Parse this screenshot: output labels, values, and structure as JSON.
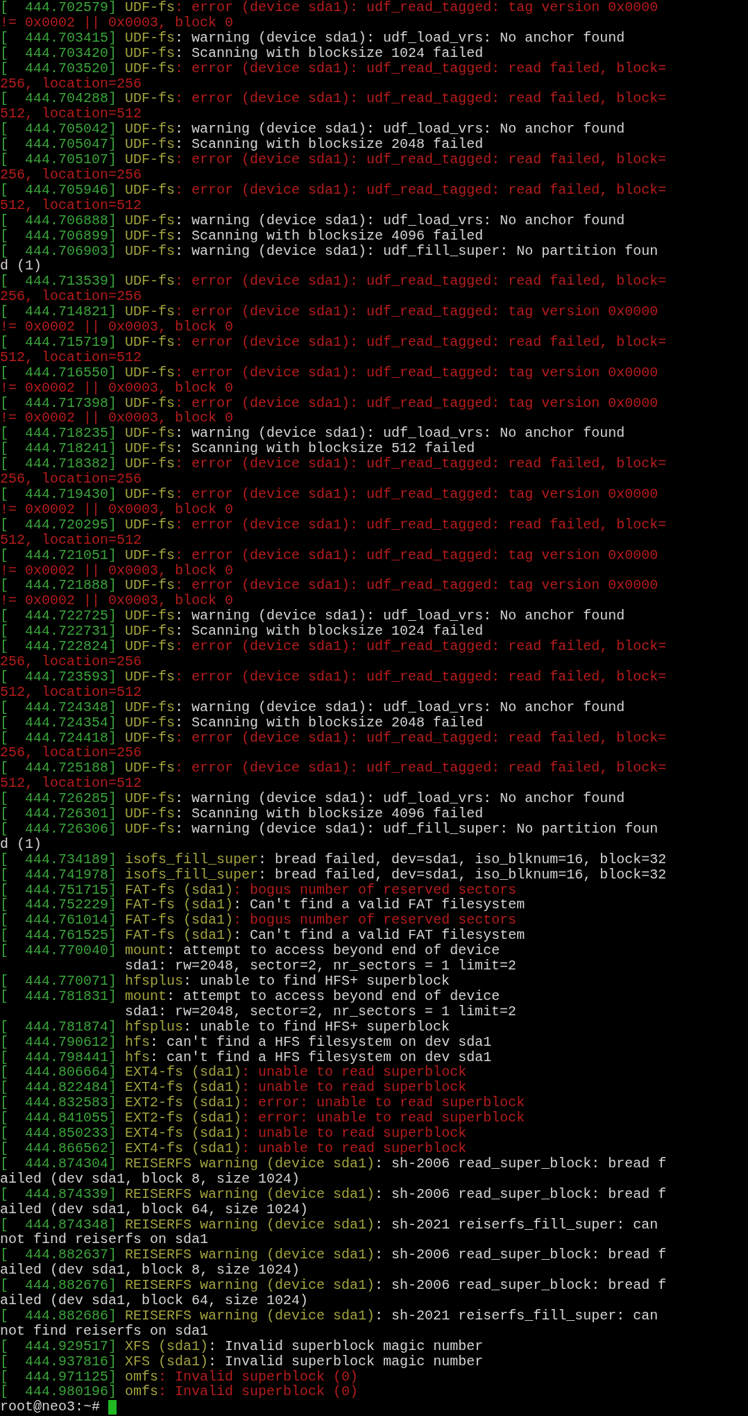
{
  "terminal": {
    "lines": [
      {
        "kind": "error",
        "stamp": "[  444.702579]",
        "source": "UDF-fs",
        "message": ": error (device sda1): udf_read_tagged: tag version 0x0000 != 0x0002 || 0x0003, block 0"
      },
      {
        "kind": "log",
        "stamp": "[  444.703415]",
        "source": "UDF-fs",
        "message": ": warning (device sda1): udf_load_vrs: No anchor found"
      },
      {
        "kind": "log",
        "stamp": "[  444.703420]",
        "source": "UDF-fs",
        "message": ": Scanning with blocksize 1024 failed"
      },
      {
        "kind": "error",
        "stamp": "[  444.703520]",
        "source": "UDF-fs",
        "message": ": error (device sda1): udf_read_tagged: read failed, block=256, location=256"
      },
      {
        "kind": "error",
        "stamp": "[  444.704288]",
        "source": "UDF-fs",
        "message": ": error (device sda1): udf_read_tagged: read failed, block=512, location=512"
      },
      {
        "kind": "log",
        "stamp": "[  444.705042]",
        "source": "UDF-fs",
        "message": ": warning (device sda1): udf_load_vrs: No anchor found"
      },
      {
        "kind": "log",
        "stamp": "[  444.705047]",
        "source": "UDF-fs",
        "message": ": Scanning with blocksize 2048 failed"
      },
      {
        "kind": "error",
        "stamp": "[  444.705107]",
        "source": "UDF-fs",
        "message": ": error (device sda1): udf_read_tagged: read failed, block=256, location=256"
      },
      {
        "kind": "error",
        "stamp": "[  444.705946]",
        "source": "UDF-fs",
        "message": ": error (device sda1): udf_read_tagged: read failed, block=512, location=512"
      },
      {
        "kind": "log",
        "stamp": "[  444.706888]",
        "source": "UDF-fs",
        "message": ": warning (device sda1): udf_load_vrs: No anchor found"
      },
      {
        "kind": "log",
        "stamp": "[  444.706899]",
        "source": "UDF-fs",
        "message": ": Scanning with blocksize 4096 failed"
      },
      {
        "kind": "log",
        "stamp": "[  444.706903]",
        "source": "UDF-fs",
        "message": ": warning (device sda1): udf_fill_super: No partition found (1)"
      },
      {
        "kind": "error",
        "stamp": "[  444.713539]",
        "source": "UDF-fs",
        "message": ": error (device sda1): udf_read_tagged: read failed, block=256, location=256"
      },
      {
        "kind": "error",
        "stamp": "[  444.714821]",
        "source": "UDF-fs",
        "message": ": error (device sda1): udf_read_tagged: tag version 0x0000 != 0x0002 || 0x0003, block 0"
      },
      {
        "kind": "error",
        "stamp": "[  444.715719]",
        "source": "UDF-fs",
        "message": ": error (device sda1): udf_read_tagged: read failed, block=512, location=512"
      },
      {
        "kind": "error",
        "stamp": "[  444.716550]",
        "source": "UDF-fs",
        "message": ": error (device sda1): udf_read_tagged: tag version 0x0000 != 0x0002 || 0x0003, block 0"
      },
      {
        "kind": "error",
        "stamp": "[  444.717398]",
        "source": "UDF-fs",
        "message": ": error (device sda1): udf_read_tagged: tag version 0x0000 != 0x0002 || 0x0003, block 0"
      },
      {
        "kind": "log",
        "stamp": "[  444.718235]",
        "source": "UDF-fs",
        "message": ": warning (device sda1): udf_load_vrs: No anchor found"
      },
      {
        "kind": "log",
        "stamp": "[  444.718241]",
        "source": "UDF-fs",
        "message": ": Scanning with blocksize 512 failed"
      },
      {
        "kind": "error",
        "stamp": "[  444.718382]",
        "source": "UDF-fs",
        "message": ": error (device sda1): udf_read_tagged: read failed, block=256, location=256"
      },
      {
        "kind": "error",
        "stamp": "[  444.719430]",
        "source": "UDF-fs",
        "message": ": error (device sda1): udf_read_tagged: tag version 0x0000 != 0x0002 || 0x0003, block 0"
      },
      {
        "kind": "error",
        "stamp": "[  444.720295]",
        "source": "UDF-fs",
        "message": ": error (device sda1): udf_read_tagged: read failed, block=512, location=512"
      },
      {
        "kind": "error",
        "stamp": "[  444.721051]",
        "source": "UDF-fs",
        "message": ": error (device sda1): udf_read_tagged: tag version 0x0000 != 0x0002 || 0x0003, block 0"
      },
      {
        "kind": "error",
        "stamp": "[  444.721888]",
        "source": "UDF-fs",
        "message": ": error (device sda1): udf_read_tagged: tag version 0x0000 != 0x0002 || 0x0003, block 0"
      },
      {
        "kind": "log",
        "stamp": "[  444.722725]",
        "source": "UDF-fs",
        "message": ": warning (device sda1): udf_load_vrs: No anchor found"
      },
      {
        "kind": "log",
        "stamp": "[  444.722731]",
        "source": "UDF-fs",
        "message": ": Scanning with blocksize 1024 failed"
      },
      {
        "kind": "error",
        "stamp": "[  444.722824]",
        "source": "UDF-fs",
        "message": ": error (device sda1): udf_read_tagged: read failed, block=256, location=256"
      },
      {
        "kind": "error",
        "stamp": "[  444.723593]",
        "source": "UDF-fs",
        "message": ": error (device sda1): udf_read_tagged: read failed, block=512, location=512"
      },
      {
        "kind": "log",
        "stamp": "[  444.724348]",
        "source": "UDF-fs",
        "message": ": warning (device sda1): udf_load_vrs: No anchor found"
      },
      {
        "kind": "log",
        "stamp": "[  444.724354]",
        "source": "UDF-fs",
        "message": ": Scanning with blocksize 2048 failed"
      },
      {
        "kind": "error",
        "stamp": "[  444.724418]",
        "source": "UDF-fs",
        "message": ": error (device sda1): udf_read_tagged: read failed, block=256, location=256"
      },
      {
        "kind": "error",
        "stamp": "[  444.725188]",
        "source": "UDF-fs",
        "message": ": error (device sda1): udf_read_tagged: read failed, block=512, location=512"
      },
      {
        "kind": "log",
        "stamp": "[  444.726285]",
        "source": "UDF-fs",
        "message": ": warning (device sda1): udf_load_vrs: No anchor found"
      },
      {
        "kind": "log",
        "stamp": "[  444.726301]",
        "source": "UDF-fs",
        "message": ": Scanning with blocksize 4096 failed"
      },
      {
        "kind": "log",
        "stamp": "[  444.726306]",
        "source": "UDF-fs",
        "message": ": warning (device sda1): udf_fill_super: No partition found (1)"
      },
      {
        "kind": "log",
        "stamp": "[  444.734189]",
        "source": "isofs_fill_super",
        "message": ": bread failed, dev=sda1, iso_blknum=16, block=32"
      },
      {
        "kind": "log",
        "stamp": "[  444.741978]",
        "source": "isofs_fill_super",
        "message": ": bread failed, dev=sda1, iso_blknum=16, block=32"
      },
      {
        "kind": "error",
        "stamp": "[  444.751715]",
        "source": "FAT-fs (sda1)",
        "message": ": bogus number of reserved sectors"
      },
      {
        "kind": "log",
        "stamp": "[  444.752229]",
        "source": "FAT-fs (sda1)",
        "message": ": Can't find a valid FAT filesystem"
      },
      {
        "kind": "error",
        "stamp": "[  444.761014]",
        "source": "FAT-fs (sda1)",
        "message": ": bogus number of reserved sectors"
      },
      {
        "kind": "log",
        "stamp": "[  444.761525]",
        "source": "FAT-fs (sda1)",
        "message": ": Can't find a valid FAT filesystem"
      },
      {
        "kind": "log",
        "stamp": "[  444.770040]",
        "source": "mount",
        "message": ": attempt to access beyond end of device"
      },
      {
        "kind": "continuation",
        "message": "               sda1: rw=2048, sector=2, nr_sectors = 1 limit=2"
      },
      {
        "kind": "log",
        "stamp": "[  444.770071]",
        "source": "hfsplus",
        "message": ": unable to find HFS+ superblock"
      },
      {
        "kind": "log",
        "stamp": "[  444.781831]",
        "source": "mount",
        "message": ": attempt to access beyond end of device"
      },
      {
        "kind": "continuation",
        "message": "               sda1: rw=2048, sector=2, nr_sectors = 1 limit=2"
      },
      {
        "kind": "log",
        "stamp": "[  444.781874]",
        "source": "hfsplus",
        "message": ": unable to find HFS+ superblock"
      },
      {
        "kind": "log",
        "stamp": "[  444.790612]",
        "source": "hfs",
        "message": ": can't find a HFS filesystem on dev sda1"
      },
      {
        "kind": "log",
        "stamp": "[  444.798441]",
        "source": "hfs",
        "message": ": can't find a HFS filesystem on dev sda1"
      },
      {
        "kind": "error",
        "stamp": "[  444.806664]",
        "source": "EXT4-fs (sda1)",
        "message": ": unable to read superblock"
      },
      {
        "kind": "error",
        "stamp": "[  444.822484]",
        "source": "EXT4-fs (sda1)",
        "message": ": unable to read superblock"
      },
      {
        "kind": "error",
        "stamp": "[  444.832583]",
        "source": "EXT2-fs (sda1)",
        "message": ": error: unable to read superblock"
      },
      {
        "kind": "error",
        "stamp": "[  444.841055]",
        "source": "EXT2-fs (sda1)",
        "message": ": error: unable to read superblock"
      },
      {
        "kind": "error",
        "stamp": "[  444.850233]",
        "source": "EXT4-fs (sda1)",
        "message": ": unable to read superblock"
      },
      {
        "kind": "error",
        "stamp": "[  444.866562]",
        "source": "EXT4-fs (sda1)",
        "message": ": unable to read superblock"
      },
      {
        "kind": "log",
        "stamp": "[  444.874304]",
        "source": "REISERFS warning (device sda1)",
        "message": ": sh-2006 read_super_block: bread failed (dev sda1, block 8, size 1024)"
      },
      {
        "kind": "log",
        "stamp": "[  444.874339]",
        "source": "REISERFS warning (device sda1)",
        "message": ": sh-2006 read_super_block: bread failed (dev sda1, block 64, size 1024)"
      },
      {
        "kind": "log",
        "stamp": "[  444.874348]",
        "source": "REISERFS warning (device sda1)",
        "message": ": sh-2021 reiserfs_fill_super: can not find reiserfs on sda1"
      },
      {
        "kind": "log",
        "stamp": "[  444.882637]",
        "source": "REISERFS warning (device sda1)",
        "message": ": sh-2006 read_super_block: bread failed (dev sda1, block 8, size 1024)"
      },
      {
        "kind": "log",
        "stamp": "[  444.882676]",
        "source": "REISERFS warning (device sda1)",
        "message": ": sh-2006 read_super_block: bread failed (dev sda1, block 64, size 1024)"
      },
      {
        "kind": "log",
        "stamp": "[  444.882686]",
        "source": "REISERFS warning (device sda1)",
        "message": ": sh-2021 reiserfs_fill_super: can not find reiserfs on sda1"
      },
      {
        "kind": "log",
        "stamp": "[  444.929517]",
        "source": "XFS (sda1)",
        "message": ": Invalid superblock magic number"
      },
      {
        "kind": "log",
        "stamp": "[  444.937816]",
        "source": "XFS (sda1)",
        "message": ": Invalid superblock magic number"
      },
      {
        "kind": "error",
        "stamp": "[  444.971125]",
        "source": "omfs",
        "message": ": Invalid superblock (0)"
      },
      {
        "kind": "error",
        "stamp": "[  444.980196]",
        "source": "omfs",
        "message": ": Invalid superblock (0)"
      },
      {
        "kind": "prompt",
        "message": "root@neo3:~# "
      }
    ]
  }
}
